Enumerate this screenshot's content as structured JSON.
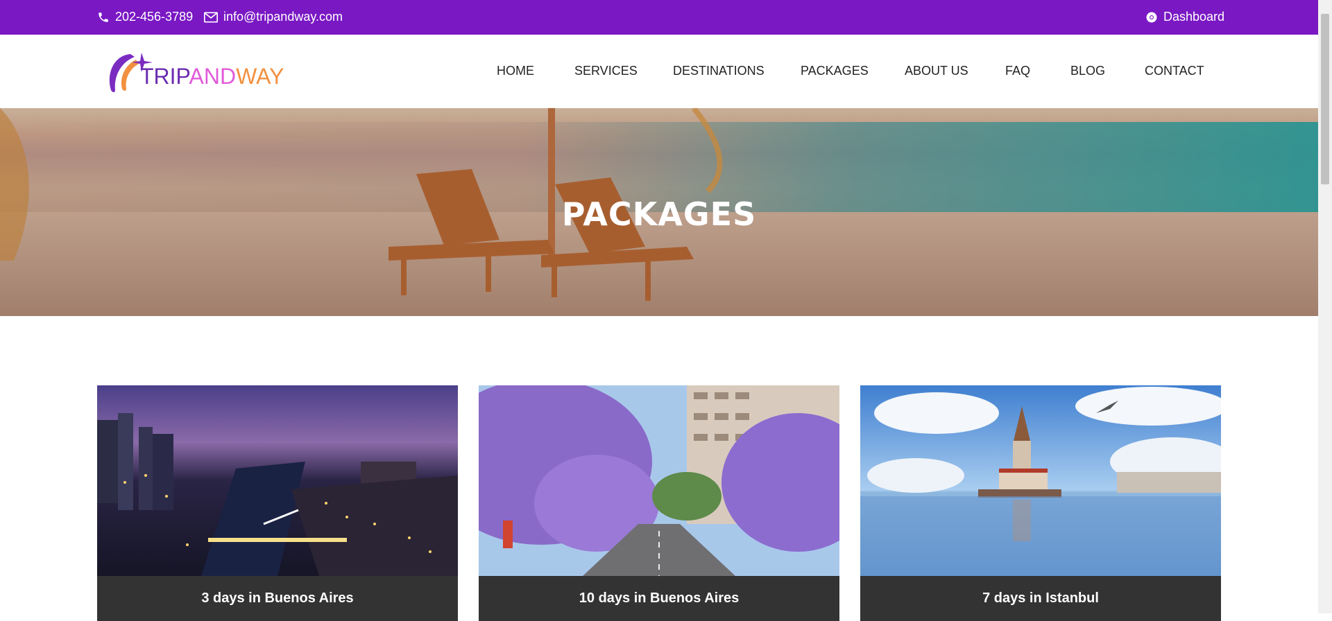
{
  "topbar": {
    "phone": "202-456-3789",
    "email": "info@tripandway.com",
    "dashboard": "Dashboard",
    "icons": [
      "phone-icon",
      "envelope-icon",
      "chrome-icon"
    ],
    "background": "#7a18c4"
  },
  "logo": {
    "part1": "TRIP",
    "part2": "AND",
    "part3": "WAY"
  },
  "nav": {
    "items": [
      {
        "label": "HOME"
      },
      {
        "label": "SERVICES"
      },
      {
        "label": "DESTINATIONS"
      },
      {
        "label": "PACKAGES"
      },
      {
        "label": "ABOUT US"
      },
      {
        "label": "FAQ"
      },
      {
        "label": "BLOG"
      },
      {
        "label": "CONTACT"
      }
    ]
  },
  "hero": {
    "title": "PACKAGES"
  },
  "packages": [
    {
      "title": "3 days in Buenos Aires"
    },
    {
      "title": "10 days in Buenos Aires"
    },
    {
      "title": "7 days in Istanbul"
    }
  ]
}
